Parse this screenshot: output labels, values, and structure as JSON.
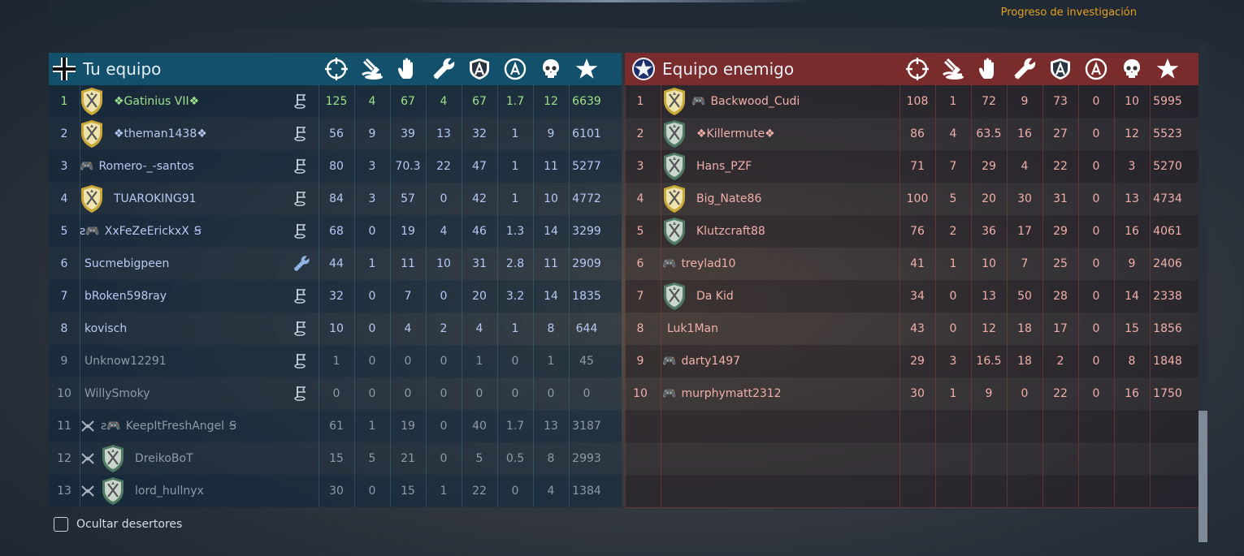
{
  "topbar": {
    "progress_link": "Progreso de investigación"
  },
  "left_team": {
    "title": "Tu equipo",
    "header_icons": [
      "crosshair-icon",
      "plane-crash-icon",
      "hand-icon",
      "wrench-icon",
      "shield-a-icon",
      "circle-a-icon",
      "skull-icon",
      "star-icon"
    ],
    "rows": [
      {
        "pos": "1",
        "prefix": "",
        "name": "❖Gatinius VII❖",
        "shield": "gold",
        "icon": "flag",
        "stats": [
          "125",
          "4",
          "67",
          "4",
          "67",
          "1.7",
          "12",
          "6639"
        ],
        "state": "highlight"
      },
      {
        "pos": "2",
        "prefix": "",
        "name": "❖theman1438❖",
        "shield": "gold",
        "icon": "flag",
        "stats": [
          "56",
          "9",
          "39",
          "13",
          "32",
          "1",
          "9",
          "6101"
        ],
        "state": "normal"
      },
      {
        "pos": "3",
        "prefix": "🎮",
        "name": "Romero-_-santos",
        "shield": "",
        "icon": "flag",
        "stats": [
          "80",
          "3",
          "70.3",
          "22",
          "47",
          "1",
          "11",
          "5277"
        ],
        "state": "normal"
      },
      {
        "pos": "4",
        "prefix": "",
        "name": "TUAROKING91",
        "shield": "gold",
        "icon": "flag",
        "stats": [
          "84",
          "3",
          "57",
          "0",
          "42",
          "1",
          "10",
          "4772"
        ],
        "state": "normal"
      },
      {
        "pos": "5",
        "prefix": "ƨ🎮",
        "name": "XxFeZeErickxX",
        "suffix": "Ꞩ",
        "shield": "",
        "icon": "flag",
        "stats": [
          "68",
          "0",
          "19",
          "4",
          "46",
          "1.3",
          "14",
          "3299"
        ],
        "state": "normal"
      },
      {
        "pos": "6",
        "prefix": "",
        "name": "Sucmebigpeen",
        "shield": "",
        "icon": "wrench",
        "stats": [
          "44",
          "1",
          "11",
          "10",
          "31",
          "2.8",
          "11",
          "2909"
        ],
        "state": "normal"
      },
      {
        "pos": "7",
        "prefix": "",
        "name": "bRoken598ray",
        "shield": "",
        "icon": "flag",
        "stats": [
          "32",
          "0",
          "7",
          "0",
          "20",
          "3.2",
          "14",
          "1835"
        ],
        "state": "normal"
      },
      {
        "pos": "8",
        "prefix": "",
        "name": "kovisch",
        "shield": "",
        "icon": "flag",
        "stats": [
          "10",
          "0",
          "4",
          "2",
          "4",
          "1",
          "8",
          "644"
        ],
        "state": "normal"
      },
      {
        "pos": "9",
        "prefix": "",
        "name": "Unknow12291",
        "shield": "",
        "icon": "flag",
        "stats": [
          "1",
          "0",
          "0",
          "0",
          "1",
          "0",
          "1",
          "45"
        ],
        "state": "dim"
      },
      {
        "pos": "10",
        "prefix": "",
        "name": "WillySmoky",
        "shield": "",
        "icon": "flag",
        "stats": [
          "0",
          "0",
          "0",
          "0",
          "0",
          "0",
          "0",
          "0"
        ],
        "state": "dim"
      },
      {
        "pos": "11",
        "prefix": "ƨ🎮",
        "name": "KeepItFreshAngel",
        "suffix": "Ꞩ",
        "shield": "",
        "icon": "",
        "deserter": true,
        "stats": [
          "61",
          "1",
          "19",
          "0",
          "40",
          "1.7",
          "13",
          "3187"
        ],
        "state": "dim"
      },
      {
        "pos": "12",
        "prefix": "",
        "name": "DreikoBoT",
        "shield": "green",
        "icon": "",
        "deserter": true,
        "stats": [
          "15",
          "5",
          "21",
          "0",
          "5",
          "0.5",
          "8",
          "2993"
        ],
        "state": "dim"
      },
      {
        "pos": "13",
        "prefix": "",
        "name": "lord_hullnyx",
        "shield": "green",
        "icon": "",
        "deserter": true,
        "stats": [
          "30",
          "0",
          "15",
          "1",
          "22",
          "0",
          "4",
          "1384"
        ],
        "state": "dim"
      }
    ]
  },
  "right_team": {
    "title": "Equipo enemigo",
    "header_icons": [
      "crosshair-icon",
      "plane-crash-icon",
      "hand-icon",
      "wrench-icon",
      "shield-a-icon",
      "circle-a-icon",
      "skull-icon",
      "star-icon"
    ],
    "rows": [
      {
        "pos": "1",
        "prefix": "🎮",
        "name": "Backwood_Cudi",
        "shield": "gold",
        "stats": [
          "108",
          "1",
          "72",
          "9",
          "73",
          "0",
          "10",
          "5995"
        ]
      },
      {
        "pos": "2",
        "prefix": "",
        "name": "❖Killermute❖",
        "shield": "green",
        "stats": [
          "86",
          "4",
          "63.5",
          "16",
          "27",
          "0",
          "12",
          "5523"
        ]
      },
      {
        "pos": "3",
        "prefix": "",
        "name": "Hans_PZF",
        "shield": "green",
        "stats": [
          "71",
          "7",
          "29",
          "4",
          "22",
          "0",
          "3",
          "5270"
        ]
      },
      {
        "pos": "4",
        "prefix": "",
        "name": "Big_Nate86",
        "shield": "gold",
        "stats": [
          "100",
          "5",
          "20",
          "30",
          "31",
          "0",
          "13",
          "4734"
        ]
      },
      {
        "pos": "5",
        "prefix": "",
        "name": "Klutzcraft88",
        "shield": "green",
        "stats": [
          "76",
          "2",
          "36",
          "17",
          "29",
          "0",
          "16",
          "4061"
        ]
      },
      {
        "pos": "6",
        "prefix": "🎮",
        "name": "treylad10",
        "shield": "",
        "stats": [
          "41",
          "1",
          "10",
          "7",
          "25",
          "0",
          "9",
          "2406"
        ]
      },
      {
        "pos": "7",
        "prefix": "",
        "name": "Da Kid",
        "shield": "green",
        "stats": [
          "34",
          "0",
          "13",
          "50",
          "28",
          "0",
          "14",
          "2338"
        ]
      },
      {
        "pos": "8",
        "prefix": "",
        "name": "Luk1Man",
        "shield": "",
        "stats": [
          "43",
          "0",
          "12",
          "18",
          "17",
          "0",
          "15",
          "1856"
        ]
      },
      {
        "pos": "9",
        "prefix": "🎮",
        "name": "darty1497",
        "shield": "",
        "stats": [
          "29",
          "3",
          "16.5",
          "18",
          "2",
          "0",
          "8",
          "1848"
        ]
      },
      {
        "pos": "10",
        "prefix": "🎮",
        "name": "murphymatt2312",
        "shield": "",
        "stats": [
          "30",
          "1",
          "9",
          "0",
          "22",
          "0",
          "16",
          "1750"
        ]
      }
    ]
  },
  "footer": {
    "hide_deserters": "Ocultar desertores"
  },
  "colors": {
    "left_header": "#13506b",
    "right_header": "#7a2b2b",
    "highlight": "#9ee28a",
    "normal": "#b7c8f5",
    "dim": "#8f9aa6",
    "enemy": "#f0b0a8",
    "accent": "#e6a21f"
  }
}
